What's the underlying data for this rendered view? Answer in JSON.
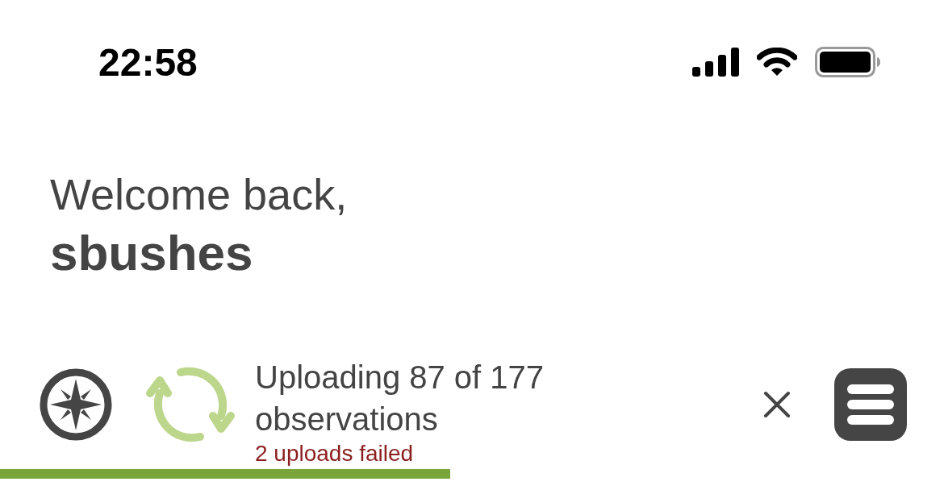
{
  "status_bar": {
    "time": "22:58"
  },
  "greeting": {
    "line": "Welcome back,",
    "username": "sbushes"
  },
  "upload": {
    "title": "Uploading 87 of 177 observations",
    "error": "2 uploads failed",
    "level": 0.477
  }
}
